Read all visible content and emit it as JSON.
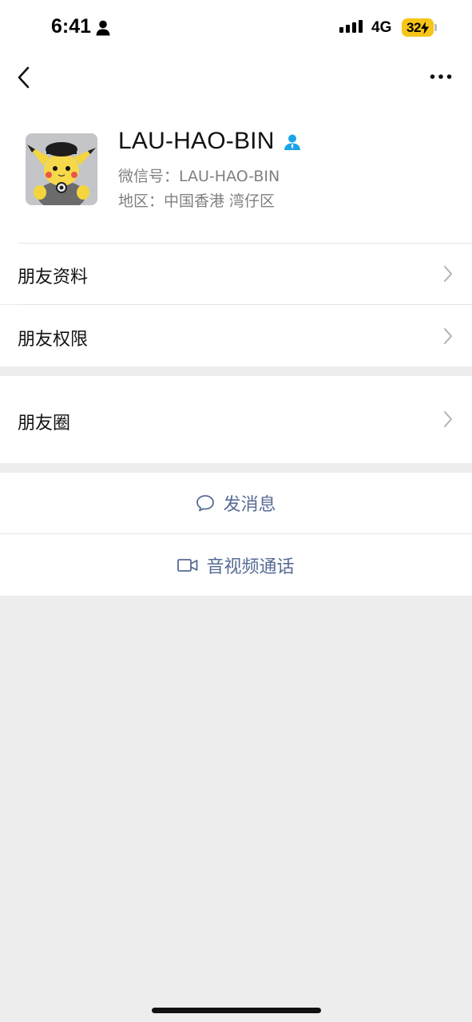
{
  "status_bar": {
    "time": "6:41",
    "network": "4G",
    "battery": "32",
    "icons": [
      "person-icon",
      "signal-icon",
      "charging-icon"
    ]
  },
  "nav": {
    "icons": [
      "back-chevron-icon",
      "more-dots-icon"
    ]
  },
  "profile": {
    "name": "LAU-HAO-BIN",
    "wechat_id": "微信号：LAU-HAO-BIN",
    "region": "地区：中国香港 湾仔区",
    "badge_icon": "contact-person-icon",
    "accent_color": "#1aa3e8"
  },
  "menu": {
    "friend_profile": "朋友资料",
    "friend_permissions": "朋友权限",
    "moments": "朋友圈"
  },
  "actions": {
    "message": "发消息",
    "call": "音视频通话",
    "link_color": "#576b95"
  }
}
